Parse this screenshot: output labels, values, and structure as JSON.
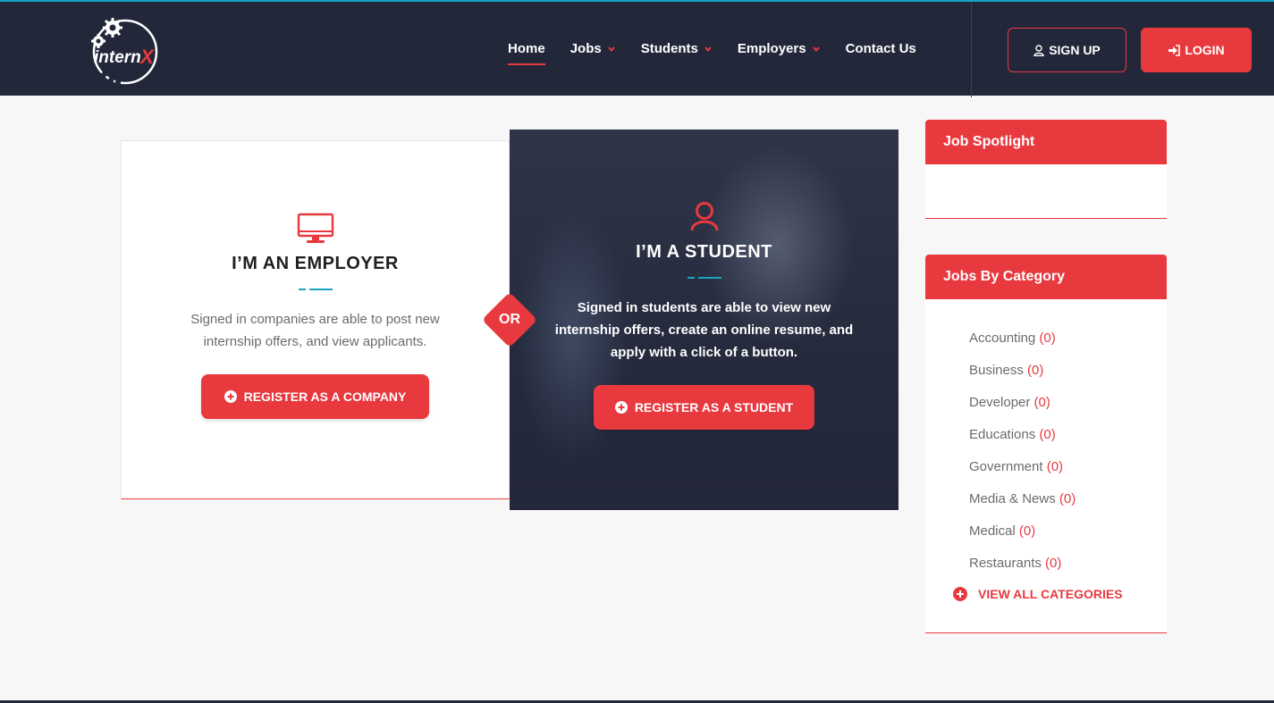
{
  "brand": {
    "logo_text": "internX"
  },
  "nav": {
    "items": [
      {
        "label": "Home"
      },
      {
        "label": "Jobs"
      },
      {
        "label": "Students"
      },
      {
        "label": "Employers"
      },
      {
        "label": "Contact Us"
      }
    ]
  },
  "auth": {
    "signup_label": "SIGN UP",
    "login_label": "LOGIN"
  },
  "employer": {
    "icon": "monitor-icon",
    "title": "I’M AN EMPLOYER",
    "description": "Signed in companies are able to post new internship offers, and view applicants.",
    "button_label": "REGISTER AS A COMPANY"
  },
  "or_label": "OR",
  "student": {
    "icon": "user-icon",
    "title": "I’M A STUDENT",
    "description": "Signed in students are able to view new internship offers, create an online resume, and apply with a click of a button.",
    "button_label": "REGISTER AS A STUDENT"
  },
  "sidebar": {
    "spotlight_title": "Job Spotlight",
    "categories_title": "Jobs By Category",
    "categories": [
      {
        "name": "Accounting",
        "count": "(0)"
      },
      {
        "name": "Business",
        "count": "(0)"
      },
      {
        "name": "Developer",
        "count": "(0)"
      },
      {
        "name": "Educations",
        "count": "(0)"
      },
      {
        "name": "Government",
        "count": "(0)"
      },
      {
        "name": "Media & News",
        "count": "(0)"
      },
      {
        "name": "Medical",
        "count": "(0)"
      },
      {
        "name": "Restaurants",
        "count": "(0)"
      }
    ],
    "view_all_label": "VIEW ALL CATEGORIES"
  },
  "colors": {
    "accent": "#e8393f",
    "header": "#23273a",
    "underline": "#1aa3c0"
  }
}
